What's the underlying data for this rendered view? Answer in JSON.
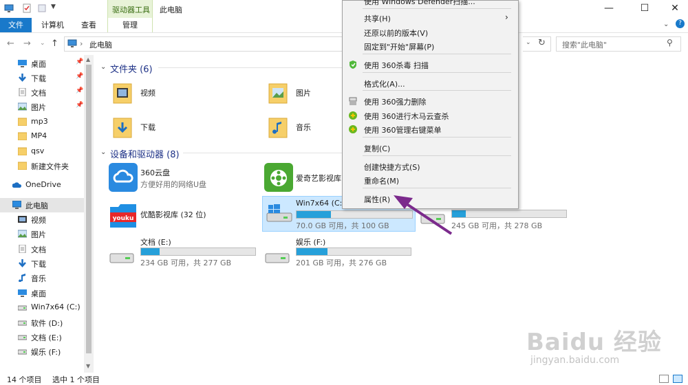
{
  "titlebar": {
    "context_tab": "驱动器工具",
    "title": "此电脑",
    "minimize_glyph": "—",
    "maximize_glyph": "☐",
    "close_glyph": "✕"
  },
  "ribbon": {
    "tabs": [
      "文件",
      "计算机",
      "查看",
      "管理"
    ],
    "help_glyph": "?"
  },
  "address": {
    "path": "此电脑",
    "search_placeholder": "搜索\"此电脑\""
  },
  "sidebar": {
    "items": [
      {
        "label": "桌面",
        "icon": "desktop-icon",
        "pinned": true
      },
      {
        "label": "下载",
        "icon": "download-icon",
        "pinned": true
      },
      {
        "label": "文档",
        "icon": "document-icon",
        "pinned": true
      },
      {
        "label": "图片",
        "icon": "picture-icon",
        "pinned": true
      },
      {
        "label": "mp3",
        "icon": "folder-icon",
        "pinned": false
      },
      {
        "label": "MP4",
        "icon": "folder-icon",
        "pinned": false
      },
      {
        "label": "qsv",
        "icon": "folder-icon",
        "pinned": false
      },
      {
        "label": "新建文件夹",
        "icon": "folder-icon",
        "pinned": false
      },
      {
        "label": "OneDrive",
        "icon": "cloud-icon",
        "pinned": false
      },
      {
        "label": "此电脑",
        "icon": "computer-icon",
        "pinned": false
      },
      {
        "label": "视频",
        "icon": "video-icon",
        "pinned": false
      },
      {
        "label": "图片",
        "icon": "picture-icon",
        "pinned": false
      },
      {
        "label": "文档",
        "icon": "document-icon",
        "pinned": false
      },
      {
        "label": "下载",
        "icon": "download-icon",
        "pinned": false
      },
      {
        "label": "音乐",
        "icon": "music-icon",
        "pinned": false
      },
      {
        "label": "桌面",
        "icon": "desktop-icon",
        "pinned": false
      },
      {
        "label": "Win7x64 (C:)",
        "icon": "drive-icon",
        "pinned": false
      },
      {
        "label": "软件 (D:)",
        "icon": "drive-icon",
        "pinned": false
      },
      {
        "label": "文档 (E:)",
        "icon": "drive-icon",
        "pinned": false
      },
      {
        "label": "娱乐 (F:)",
        "icon": "drive-icon",
        "pinned": false
      }
    ]
  },
  "folders": {
    "group_title": "文件夹 (6)",
    "items": [
      "视频",
      "图片",
      "下载",
      "音乐"
    ]
  },
  "devices": {
    "group_title": "设备和驱动器 (8)",
    "cloud360": {
      "name": "360云盘",
      "sub": "方便好用的网络U盘"
    },
    "iqiyi": {
      "name": "爱奇艺影视库"
    },
    "youku": {
      "name": "优酷影视库 (32 位)"
    },
    "drive_c": {
      "name": "Win7x64 (C:)",
      "space": "70.0 GB 可用，共 100 GB",
      "used_fraction": 0.3
    },
    "drive_d": {
      "space": "245 GB 可用，共 278 GB",
      "used_fraction": 0.12
    },
    "drive_e": {
      "name": "文档 (E:)",
      "space": "234 GB 可用，共 277 GB",
      "used_fraction": 0.16
    },
    "drive_f": {
      "name": "娱乐 (F:)",
      "space": "201 GB 可用，共 276 GB",
      "used_fraction": 0.27
    }
  },
  "context_menu": {
    "top_partial": "使用 Windows Defender扫描...",
    "items": [
      {
        "label": "共享(H)",
        "submenu": true
      },
      {
        "label": "还原以前的版本(V)"
      },
      {
        "label": "固定到\"开始\"屏幕(P)"
      },
      {
        "label": "使用 360杀毒 扫描",
        "icon": "360-antivirus-icon"
      },
      {
        "label": "格式化(A)..."
      },
      {
        "label": "使用 360强力删除",
        "icon": "shredder-icon"
      },
      {
        "label": "使用 360进行木马云查杀",
        "icon": "360-guard-icon"
      },
      {
        "label": "使用 360管理右键菜单",
        "icon": "360-guard-icon"
      },
      {
        "label": "复制(C)"
      },
      {
        "label": "创建快捷方式(S)"
      },
      {
        "label": "重命名(M)"
      },
      {
        "label": "属性(R)"
      }
    ]
  },
  "status": {
    "count": "14 个项目",
    "selected": "选中 1 个项目"
  },
  "watermark": {
    "brand": "Baidu 经验",
    "url": "jingyan.baidu.com"
  },
  "colors": {
    "accent": "#1979ca",
    "bar_fill": "#26a0da",
    "arrow": "#7b2a8c"
  }
}
